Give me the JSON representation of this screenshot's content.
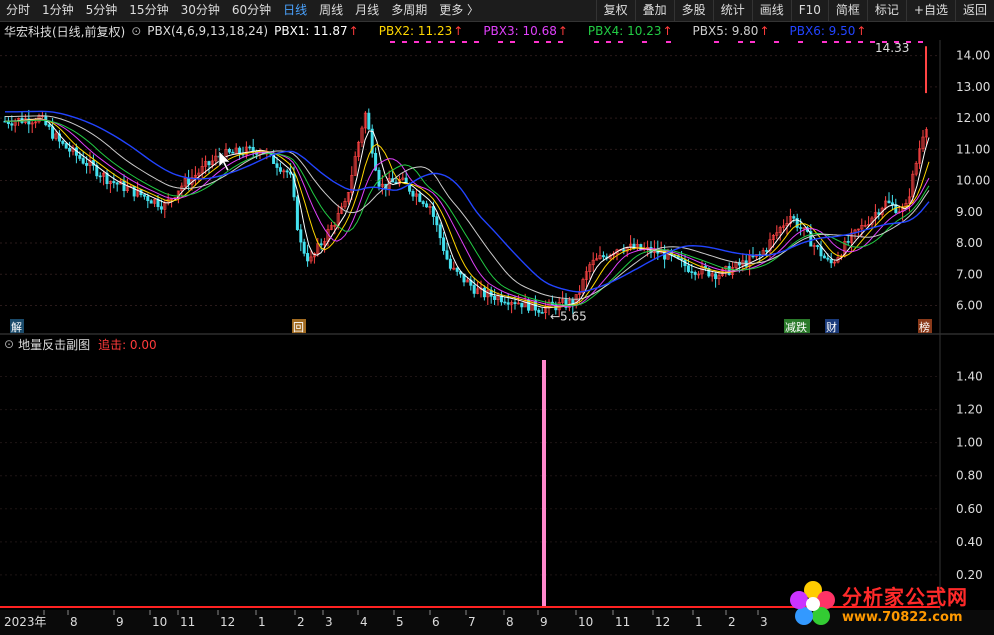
{
  "toolbar": {
    "periods": [
      "分时",
      "1分钟",
      "5分钟",
      "15分钟",
      "30分钟",
      "60分钟",
      "日线",
      "周线",
      "月线",
      "多周期",
      "更多 〉"
    ],
    "active_period": "日线",
    "right_buttons": [
      "复权",
      "叠加",
      "多股",
      "统计",
      "画线",
      "F10",
      "简框",
      "标记",
      "+自选",
      "返回"
    ]
  },
  "info": {
    "stock_name": "华宏科技(日线,前复权)",
    "indicator": "PBX(4,6,9,13,18,24)",
    "pbx": [
      {
        "label": "PBX1: 11.87",
        "color": "#ffffff"
      },
      {
        "label": "PBX2: 11.23",
        "color": "#ffd700"
      },
      {
        "label": "PBX3: 10.68",
        "color": "#e040fb"
      },
      {
        "label": "PBX4: 10.23",
        "color": "#22cc44"
      },
      {
        "label": "PBX5: 9.80",
        "color": "#cccccc"
      },
      {
        "label": "PBX6: 9.50",
        "color": "#2244ff"
      }
    ]
  },
  "main_axis": {
    "labels": [
      "14.00",
      "13.00",
      "12.00",
      "11.00",
      "10.00",
      "9.00",
      "8.00",
      "7.00",
      "6.00"
    ]
  },
  "annotations": {
    "high": "14.33",
    "low": "5.65",
    "marker_jie": "解",
    "marker_hui": "回",
    "marker_jiandie": "减跌",
    "marker_cai": "财",
    "marker_bang": "榜"
  },
  "sub_panel": {
    "title": "地量反击副图",
    "value_label": "追击: 0.00",
    "axis_labels": [
      "1.40",
      "1.20",
      "1.00",
      "0.80",
      "0.60",
      "0.40",
      "0.20"
    ]
  },
  "x_axis": {
    "labels": [
      "2023年",
      "8",
      "9",
      "10",
      "11",
      "12",
      "1",
      "2",
      "3",
      "4",
      "5",
      "6",
      "7",
      "8",
      "9",
      "10",
      "11",
      "12",
      "1",
      "2",
      "3"
    ]
  },
  "watermark": {
    "title": "分析家公式网",
    "url": "www.70822.com"
  },
  "colors": {
    "up": "#ff4444",
    "down": "#44e0ee",
    "spike": "#ff88cc",
    "pbx_purple": "#ff33cc"
  }
}
